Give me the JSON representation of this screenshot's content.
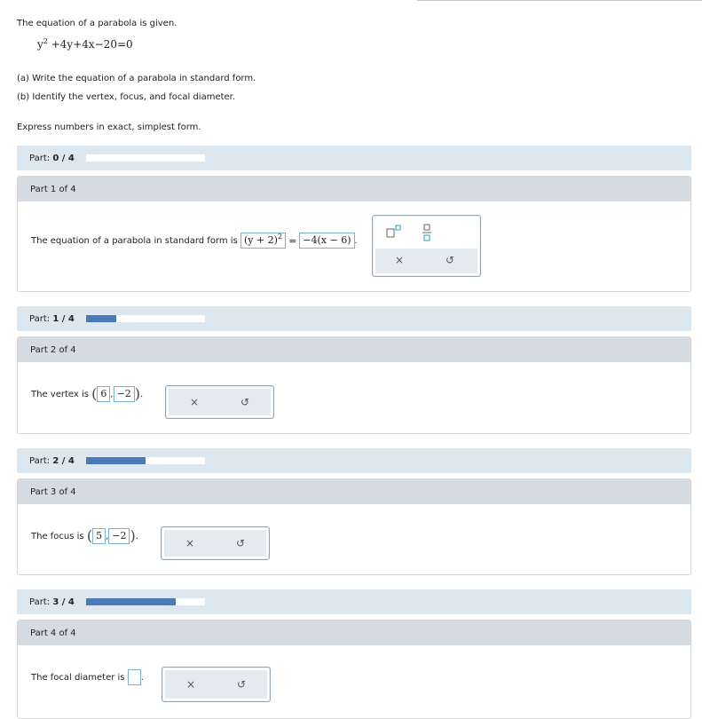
{
  "problem": {
    "intro": "The equation of a parabola is given.",
    "equation": {
      "base": "y",
      "exp": "2",
      "rest": "+4y+4x−20=0"
    },
    "part_a": "(a) Write the equation of a parabola in standard form.",
    "part_b": "(b) Identify the vertex, focus, and focal diameter.",
    "note": "Express numbers in exact, simplest form."
  },
  "progress_bars": [
    {
      "label": "Part:",
      "value": "0 / 4",
      "fraction": 0.0
    },
    {
      "label": "Part:",
      "value": "1 / 4",
      "fraction": 0.25
    },
    {
      "label": "Part:",
      "value": "2 / 4",
      "fraction": 0.5
    },
    {
      "label": "Part:",
      "value": "3 / 4",
      "fraction": 0.75
    }
  ],
  "parts": [
    {
      "header": "Part 1 of 4",
      "prompt": "The equation of a parabola in standard form is",
      "answer_left": {
        "text": "(y + 2)",
        "exp": "2"
      },
      "equals": "=",
      "answer_right": "−4(x − 6)"
    },
    {
      "header": "Part 2 of 4",
      "prompt": "The vertex is",
      "x": "6",
      "y": "−2"
    },
    {
      "header": "Part 3 of 4",
      "prompt": "The focus is",
      "x": "5",
      "y": "−2"
    },
    {
      "header": "Part 4 of 4",
      "prompt": "The focal diameter is",
      "value": ""
    }
  ],
  "tools": {
    "clear_glyph": "×",
    "undo_glyph": "↺"
  }
}
